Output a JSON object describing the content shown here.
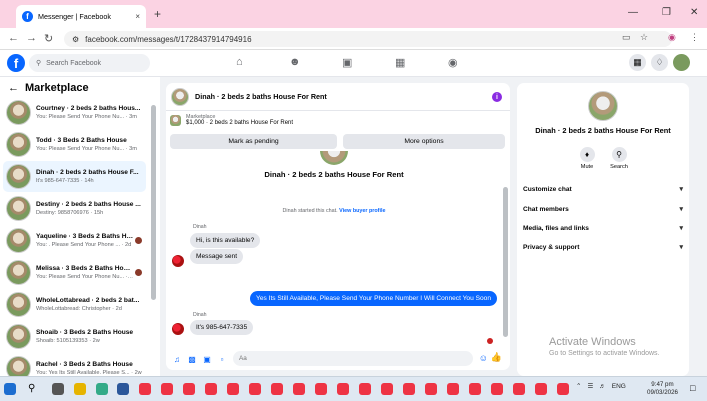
{
  "browser": {
    "tab_title": "Messenger | Facebook",
    "url": "facebook.com/messages/t/1728437914794916",
    "new_tab": "+",
    "close_tab": "×"
  },
  "fb": {
    "logo": "f",
    "search_placeholder": "Search Facebook"
  },
  "sidebar": {
    "title": "Marketplace",
    "conversations": [
      {
        "name": "Courtney · 2 beds 2 baths Hous...",
        "preview": "You: Please Send Your Phone Nu... · 3m"
      },
      {
        "name": "Todd · 3 Beds 2 Baths House",
        "preview": "You: Please Send Your Phone Nu... · 3m"
      },
      {
        "name": "Dinah · 2 beds 2 baths House F...",
        "preview": "It's 985-647-7335 · 14h"
      },
      {
        "name": "Destiny · 2 beds 2 baths House ...",
        "preview": "Destiny: 9858706976 · 15h"
      },
      {
        "name": "Yaqueline · 3 Beds 2 Baths Ho...",
        "preview": "You: . Please Send Your Phone ... · 2d"
      },
      {
        "name": "Melissa · 3 Beds 2 Baths House",
        "preview": "You: Please Send Your Phone Nu... · 2d"
      },
      {
        "name": "WholeLottabread · 2 beds 2 bat...",
        "preview": "WholeLottabread: Christopher · 2d"
      },
      {
        "name": "Shoaib · 3 Beds 2 Baths House",
        "preview": "Shoaib: 5105139353 · 2w"
      },
      {
        "name": "Rachel · 3 Beds 2 Baths House",
        "preview": "You: Yes Its Still Available. Please S... · 2w"
      }
    ]
  },
  "chat": {
    "title": "Dinah · 2 beds 2 baths House For Rent",
    "marketplace_label": "Marketplace",
    "listing": "$1,000 · 2 beds 2 baths House For Rent",
    "mark_pending": "Mark as pending",
    "more_options": "More options",
    "big_name": "Dinah · 2 beds 2 baths House For Rent",
    "started_text": "Dinah started this chat.",
    "view_profile": "View buyer profile",
    "sender1": "Dinah",
    "msg1": "Hi, is this available?",
    "msg2": "Message sent",
    "msg_out": "Yes Its Still Available, Please Send Your Phone Number I Will Connect You Soon",
    "sender2": "Dinah",
    "msg3": "It's 985-647-7335",
    "input_placeholder": "Aa"
  },
  "info_panel": {
    "name": "Dinah · 2 beds 2 baths House For Rent",
    "mute": "Mute",
    "search": "Search",
    "rows": [
      "Customize chat",
      "Chat members",
      "Media, files and links",
      "Privacy & support"
    ]
  },
  "watermark": {
    "line1": "Activate Windows",
    "line2": "Go to Settings to activate Windows."
  },
  "taskbar": {
    "lang": "ENG",
    "time": "9:47 pm",
    "date": "09/03/2026"
  },
  "colors": {
    "accent": "#0866ff",
    "tabbar": "#fbd3e3"
  }
}
